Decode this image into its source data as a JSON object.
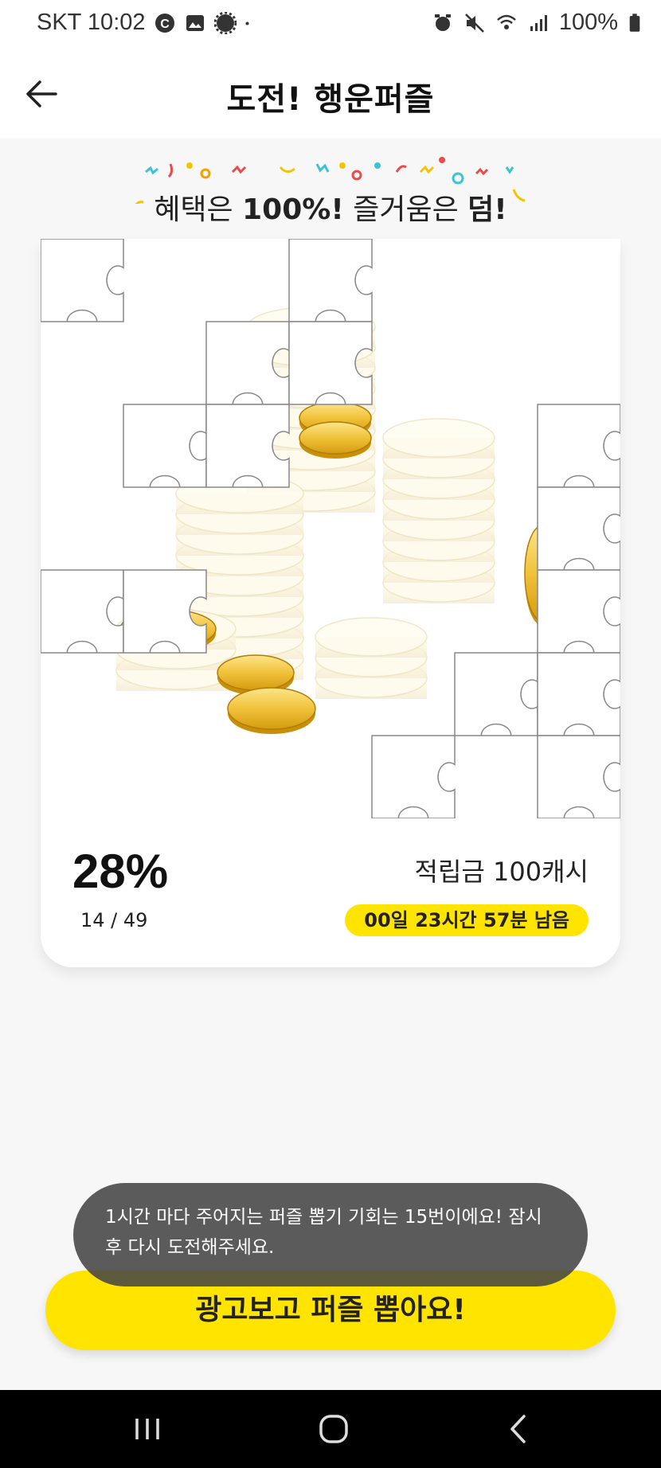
{
  "status_bar": {
    "carrier_time": "SKT 10:02",
    "battery": "100%",
    "icons": [
      "c-icon",
      "image-icon",
      "gear-badge-icon",
      "dot-icon",
      "alarm-icon",
      "mute-icon",
      "wifi-icon",
      "signal-icon",
      "battery-icon"
    ]
  },
  "header": {
    "title": "도전! 행운퍼즐",
    "back_icon": "arrow-left-icon"
  },
  "promo": {
    "part1": "혜택은 ",
    "part2": "100%!",
    "part3": " 즐거움은 ",
    "part4": "덤!"
  },
  "puzzle": {
    "grid": 7,
    "revealed": 14,
    "total": 49
  },
  "progress": {
    "percent": "28%",
    "count": "14 / 49",
    "reward": "적립금 100캐시",
    "time_left": "00일 23시간 57분 남음"
  },
  "toast": {
    "message": "1시간 마다 주어지는 퍼즐 뽑기 기회는 15번이에요! 잠시 후 다시 도전해주세요."
  },
  "cta": {
    "label": "광고보고 퍼즐 뽑아요!"
  },
  "colors": {
    "accent": "#ffe400",
    "background": "#f7f7f7",
    "gold": "#e8b62a"
  },
  "nav": {
    "icons": [
      "recent-apps-icon",
      "home-icon",
      "back-icon"
    ]
  }
}
